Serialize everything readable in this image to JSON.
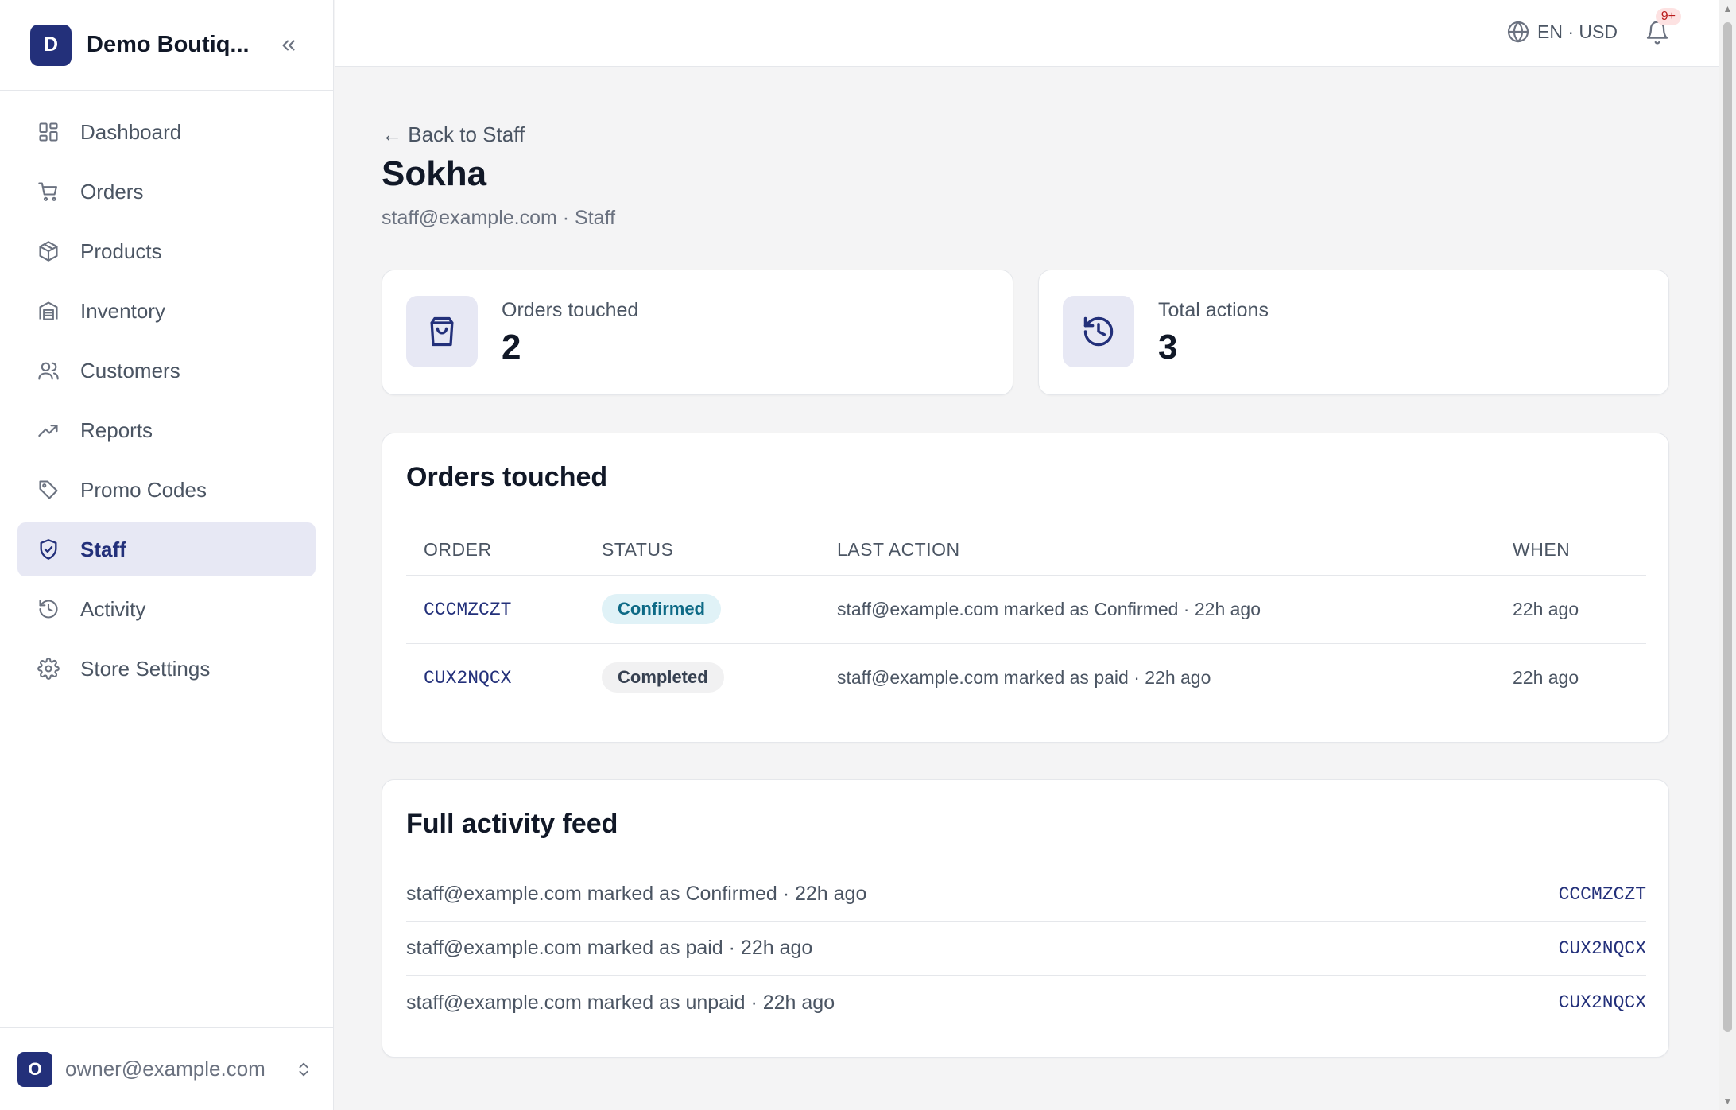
{
  "sidebar": {
    "brand_initial": "D",
    "brand_name": "Demo Boutiq...",
    "items": [
      {
        "label": "Dashboard",
        "icon": "dashboard-icon"
      },
      {
        "label": "Orders",
        "icon": "cart-icon"
      },
      {
        "label": "Products",
        "icon": "box-icon"
      },
      {
        "label": "Inventory",
        "icon": "warehouse-icon"
      },
      {
        "label": "Customers",
        "icon": "users-icon"
      },
      {
        "label": "Reports",
        "icon": "trend-icon"
      },
      {
        "label": "Promo Codes",
        "icon": "tag-icon"
      },
      {
        "label": "Staff",
        "icon": "shield-icon",
        "active": true
      },
      {
        "label": "Activity",
        "icon": "history-icon"
      },
      {
        "label": "Store Settings",
        "icon": "gear-icon"
      }
    ],
    "user_initial": "O",
    "user_email": "owner@example.com"
  },
  "topbar": {
    "locale": "EN · USD",
    "notification_badge": "9+"
  },
  "page": {
    "back_link": "← Back to Staff",
    "title": "Sokha",
    "subtitle": "staff@example.com · Staff"
  },
  "stats": [
    {
      "label": "Orders touched",
      "value": "2",
      "icon": "bag-icon"
    },
    {
      "label": "Total actions",
      "value": "3",
      "icon": "history-icon"
    }
  ],
  "orders_touched": {
    "title": "Orders touched",
    "columns": [
      "ORDER",
      "STATUS",
      "LAST ACTION",
      "WHEN"
    ],
    "rows": [
      {
        "order": "CCCMZCZT",
        "status": "Confirmed",
        "last_action": "staff@example.com marked as Confirmed · 22h ago",
        "when": "22h ago"
      },
      {
        "order": "CUX2NQCX",
        "status": "Completed",
        "last_action": "staff@example.com marked as paid · 22h ago",
        "when": "22h ago"
      }
    ]
  },
  "activity_feed": {
    "title": "Full activity feed",
    "items": [
      {
        "text": "staff@example.com marked as Confirmed · 22h ago",
        "order": "CCCMZCZT"
      },
      {
        "text": "staff@example.com marked as paid · 22h ago",
        "order": "CUX2NQCX"
      },
      {
        "text": "staff@example.com marked as unpaid · 22h ago",
        "order": "CUX2NQCX"
      }
    ]
  },
  "colors": {
    "brand": "#23307a",
    "active_bg": "#e7e8f4",
    "confirmed_bg": "#e0f2f7",
    "confirmed_text": "#0e6a86"
  }
}
